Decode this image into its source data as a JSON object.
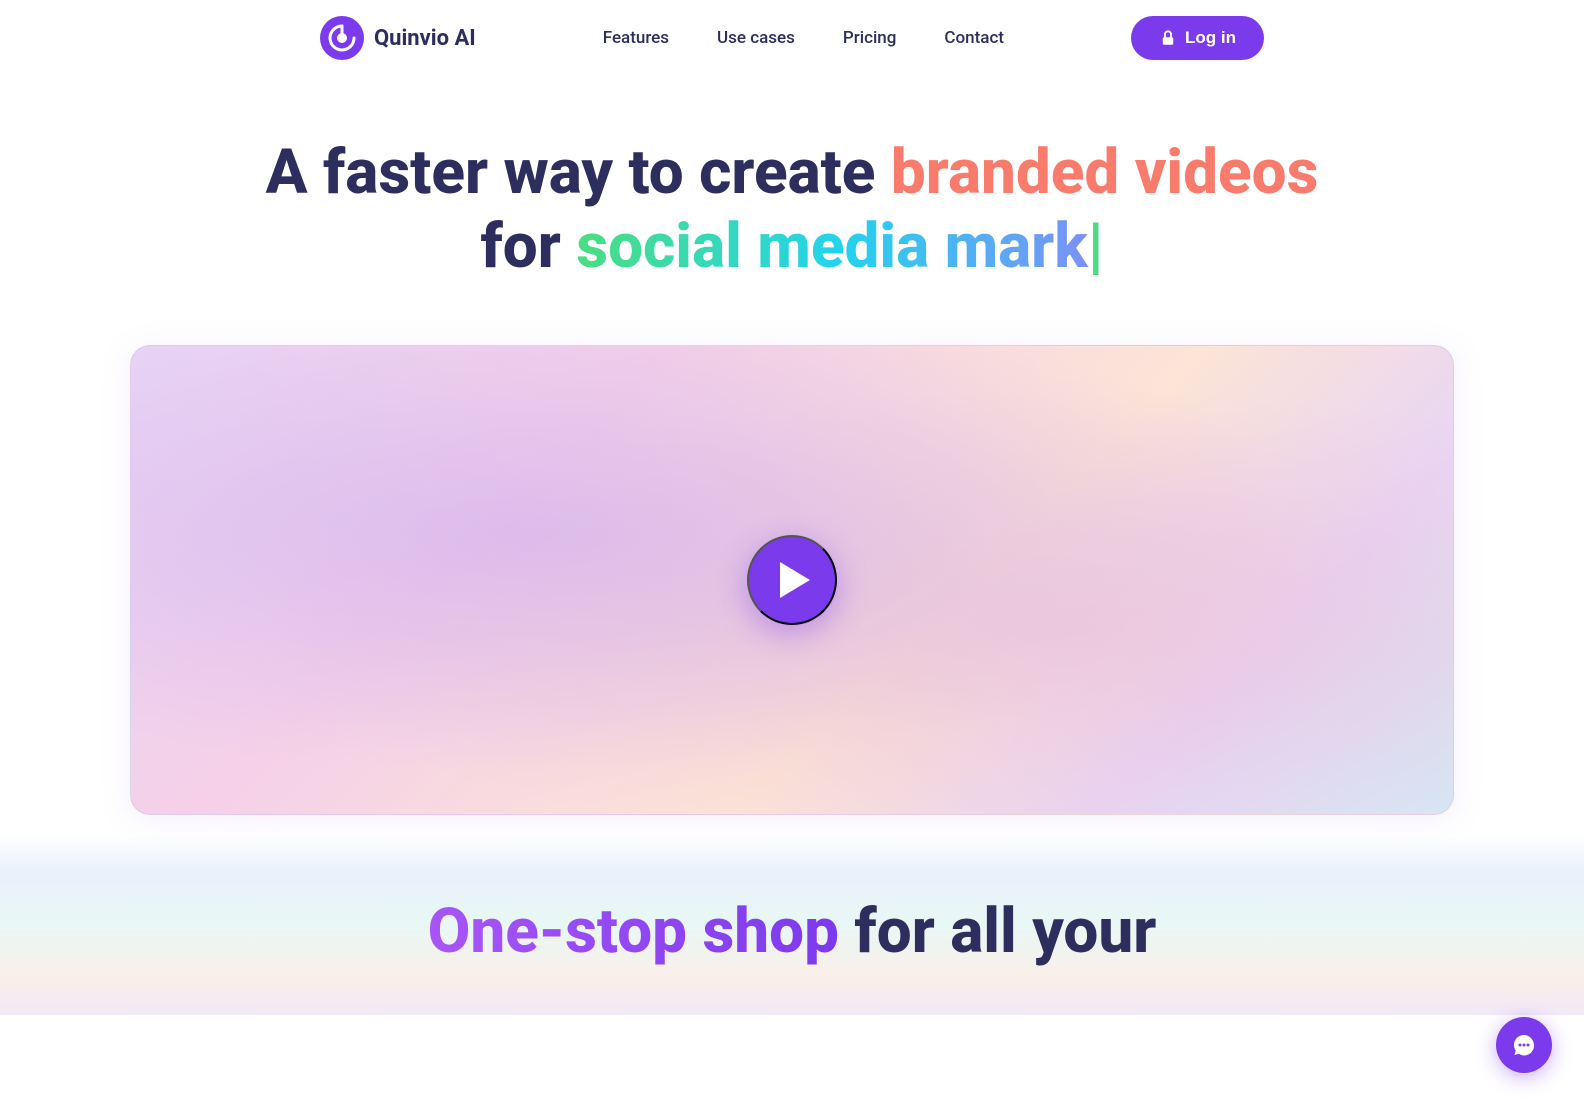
{
  "navbar": {
    "logo_text": "Quinvio AI",
    "nav_links": [
      {
        "id": "features",
        "label": "Features"
      },
      {
        "id": "use-cases",
        "label": "Use cases"
      },
      {
        "id": "pricing",
        "label": "Pricing"
      },
      {
        "id": "contact",
        "label": "Contact"
      }
    ],
    "login_label": "Log in"
  },
  "hero": {
    "title_line1_static": "A faster way to create ",
    "title_line1_highlight": "branded videos",
    "title_line2_static": "for ",
    "title_line2_highlight": "social media mark",
    "cursor": "|"
  },
  "video": {
    "play_label": "Play video"
  },
  "bottom": {
    "title_highlight": "One-stop shop",
    "title_static": " for all your"
  },
  "colors": {
    "brand_purple": "#7c3aed",
    "text_dark": "#2d2d5e",
    "orange_highlight": "#f97b6b",
    "green_highlight": "#4ade80"
  }
}
